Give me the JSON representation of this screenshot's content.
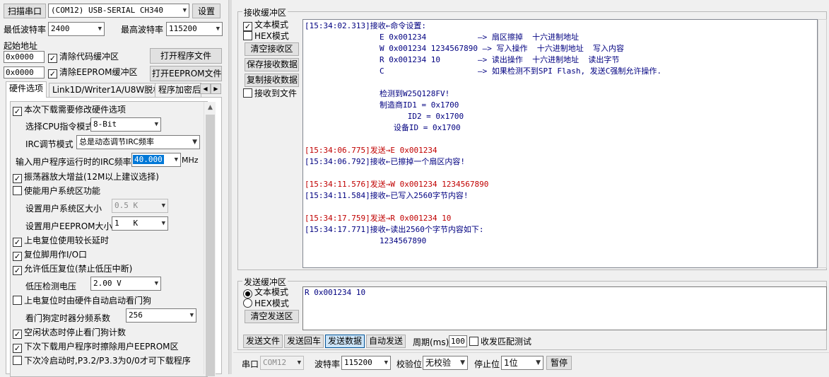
{
  "top": {
    "scan_port": "扫描串口",
    "port_value": "(COM12) USB-SERIAL CH340",
    "settings": "设置",
    "min_baud_label": "最低波特率",
    "min_baud_value": "2400",
    "max_baud_label": "最高波特率",
    "max_baud_value": "115200",
    "start_addr_label": "起始地址",
    "addr1_value": "0x0000",
    "clear_code_label": "清除代码缓冲区",
    "open_program": "打开程序文件",
    "addr2_value": "0x0000",
    "clear_eeprom_label": "清除EEPROM缓冲区",
    "open_eeprom": "打开EEPROM文件"
  },
  "tabs": [
    "硬件选项",
    "Link1D/Writer1A/U8W脱机",
    "程序加密后"
  ],
  "hw": {
    "modify_hw": "本次下载需要修改硬件选项",
    "cpu_label": "选择CPU指令模式",
    "cpu_value": "8-Bit",
    "irc_mode_label": "IRC调节模式",
    "irc_mode_value": "总是动态调节IRC频率",
    "irc_freq_label": "输入用户程序运行时的IRC频率",
    "irc_freq_value": "40.000",
    "irc_unit": "MHz",
    "osc_gain": "振荡器放大增益(12M以上建议选择)",
    "user_sys_area": "使能用户系统区功能",
    "sys_size_label": "设置用户系统区大小",
    "sys_size_value": "0.5 K",
    "eeprom_size_label": "设置用户EEPROM大小",
    "eeprom_size_value": "1   K",
    "long_delay": "上电复位使用较长延时",
    "reset_io": "复位脚用作I/O口",
    "lvr": "允许低压复位(禁止低压中断)",
    "lvd_label": "低压检测电压",
    "lvd_value": "2.00 V",
    "wdt_hw": "上电复位时由硬件自动启动看门狗",
    "wdt_div_label": "看门狗定时器分频系数",
    "wdt_div_value": "256",
    "idle_wdt": "空闲状态时停止看门狗计数",
    "erase_eeprom": "下次下载用户程序时擦除用户EEPROM区",
    "p32p33": "下次冷启动时,P3.2/P3.3为0/0才可下载程序"
  },
  "recv": {
    "title": "接收缓冲区",
    "text_mode": "文本模式",
    "hex_mode": "HEX模式",
    "clear": "清空接收区",
    "save": "保存接收数据",
    "copy": "复制接收数据",
    "to_file": "接收到文件",
    "lines": [
      {
        "text": "[15:34:02.313]接收←命令设置:",
        "color": "blue"
      },
      {
        "text": "                E 0x001234           —> 扇区擦掉  十六进制地址",
        "color": "blue"
      },
      {
        "text": "                W 0x001234 1234567890 —> 写入操作  十六进制地址  写入内容",
        "color": "blue"
      },
      {
        "text": "                R 0x001234 10        —> 读出操作  十六进制地址  读出字节",
        "color": "blue"
      },
      {
        "text": "                C                    —> 如果检测不到SPI Flash, 发送C强制允许操作.",
        "color": "blue"
      },
      {
        "text": "",
        "color": "blue"
      },
      {
        "text": "                检测到W25Q128FV!",
        "color": "blue"
      },
      {
        "text": "                制造商ID1 = 0x1700",
        "color": "blue"
      },
      {
        "text": "                      ID2 = 0x1700",
        "color": "blue"
      },
      {
        "text": "                   设备ID = 0x1700",
        "color": "blue"
      },
      {
        "text": "",
        "color": "blue"
      },
      {
        "text": "[15:34:06.775]发送→E 0x001234",
        "color": "red"
      },
      {
        "text": "[15:34:06.792]接收←已擦掉一个扇区内容!",
        "color": "blue"
      },
      {
        "text": "",
        "color": "blue"
      },
      {
        "text": "[15:34:11.576]发送→W 0x001234 1234567890",
        "color": "red"
      },
      {
        "text": "[15:34:11.584]接收←已写入2560字节内容!",
        "color": "blue"
      },
      {
        "text": "",
        "color": "blue"
      },
      {
        "text": "[15:34:17.759]发送→R 0x001234 10",
        "color": "red"
      },
      {
        "text": "[15:34:17.771]接收←读出2560个字节内容如下:",
        "color": "blue"
      },
      {
        "text": "                1234567890",
        "color": "blue"
      }
    ]
  },
  "send": {
    "title": "发送缓冲区",
    "text_mode": "文本模式",
    "hex_mode": "HEX模式",
    "clear": "清空发送区",
    "content": "R 0x001234 10",
    "send_file": "发送文件",
    "send_cr": "发送回车",
    "send_data": "发送数据",
    "auto_send": "自动发送",
    "period_label": "周期(ms)",
    "period_value": "100",
    "match_test": "收发匹配测试"
  },
  "bottom": {
    "port_label": "串口",
    "port_value": "COM12",
    "baud_label": "波特率",
    "baud_value": "115200",
    "parity_label": "校验位",
    "parity_value": "无校验",
    "stop_label": "停止位",
    "stop_value": "1位",
    "pause": "暂停"
  }
}
